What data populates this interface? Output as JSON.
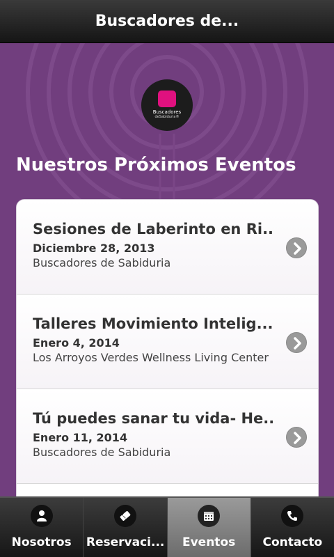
{
  "app": {
    "title": "Buscadores de..."
  },
  "logo": {
    "line1": "Buscadores",
    "line2": "deSabiduria®"
  },
  "section": {
    "title": "Nuestros Próximos Eventos"
  },
  "events": [
    {
      "title": "Sesiones de Laberinto en Ri...",
      "date": "Diciembre 28, 2013",
      "venue": "Buscadores de Sabiduria"
    },
    {
      "title": "Talleres Movimiento Intelig...",
      "date": "Enero 4, 2014",
      "venue": "Los Arroyos Verdes Wellness Living Center"
    },
    {
      "title": "Tú puedes sanar tu vida- He...",
      "date": "Enero 11, 2014",
      "venue": "Buscadores de Sabiduria"
    }
  ],
  "tabs": [
    {
      "label": "Nosotros",
      "icon": "person-icon",
      "active": false
    },
    {
      "label": "Reservaci...",
      "icon": "ticket-icon",
      "active": false
    },
    {
      "label": "Eventos",
      "icon": "calendar-icon",
      "active": true
    },
    {
      "label": "Contacto",
      "icon": "phone-icon",
      "active": false
    }
  ],
  "colors": {
    "background": "#713e7e",
    "accent": "#e0117f",
    "titlebar": "#1f1f1f"
  }
}
